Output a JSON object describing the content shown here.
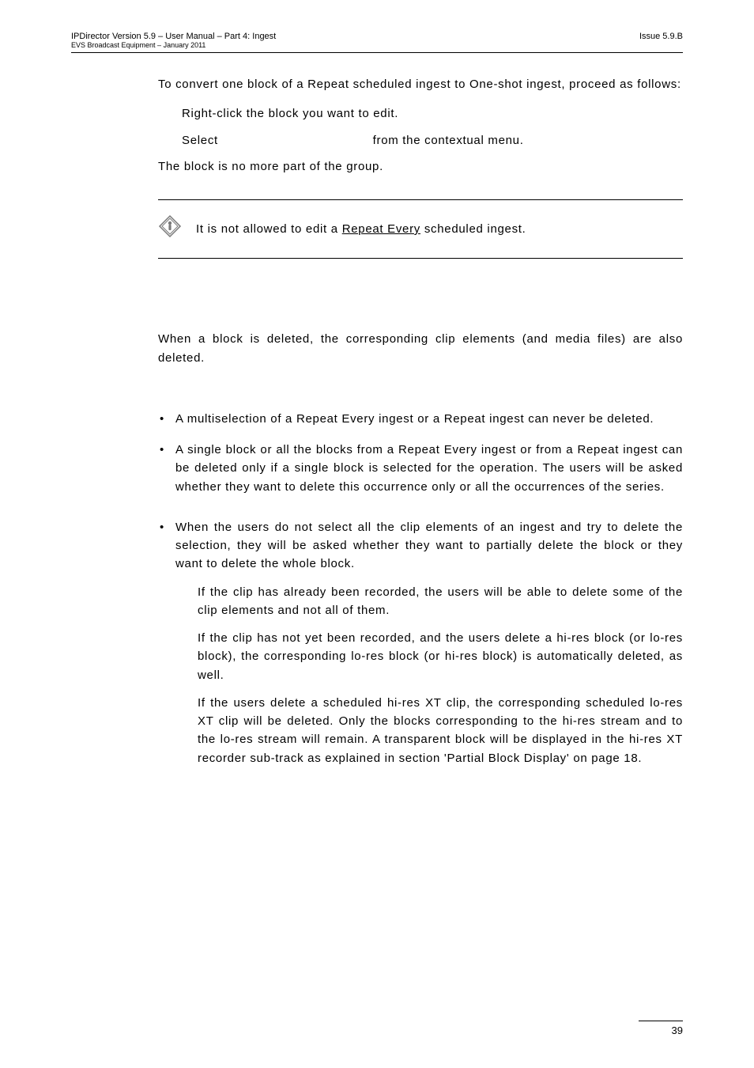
{
  "header": {
    "left_top": "IPDirector Version 5.9 – User Manual – Part 4: Ingest",
    "left_bottom": "EVS Broadcast Equipment – January 2011",
    "right": "Issue 5.9.B"
  },
  "intro": {
    "p1": "To convert one block of a Repeat scheduled ingest to One-shot ingest, proceed as follows:",
    "step1": "Right-click the block you want to edit.",
    "step2_a": "Select",
    "step2_b": "from the contextual menu.",
    "p2": "The block is no more part of the group."
  },
  "note": {
    "prefix": "It is not allowed to edit a ",
    "underlined": "Repeat Every",
    "suffix": " scheduled ingest."
  },
  "deleted_intro": "When a block is deleted, the corresponding clip elements (and media files) are also deleted.",
  "bullets": {
    "b1": "A multiselection of a Repeat Every ingest or a Repeat ingest can never be deleted.",
    "b2": "A single block or all the blocks from a Repeat Every ingest or from a Repeat ingest can be deleted only if a single block is selected for the operation. The users will be asked whether they want to delete this occurrence only or all the occurrences of the series.",
    "b3": "When the users do not select all the clip elements of an ingest and try to delete the selection, they will be asked whether they want to partially delete the block or they want to delete the whole block.",
    "b3_s1": "If the clip has already been recorded, the users will be able to delete some of the clip elements and not all of them.",
    "b3_s2": "If the clip has not yet been recorded, and the users delete a hi-res block (or lo-res block), the corresponding lo-res block (or hi-res block) is automatically deleted, as well.",
    "b3_s3": "If the users delete a scheduled hi-res XT clip, the corresponding scheduled lo-res XT clip will be deleted. Only the blocks corresponding to the hi-res stream and to the lo-res stream will remain. A transparent block will be displayed in the hi-res XT recorder sub-track as explained in section 'Partial Block Display' on page 18."
  },
  "page_number": "39"
}
